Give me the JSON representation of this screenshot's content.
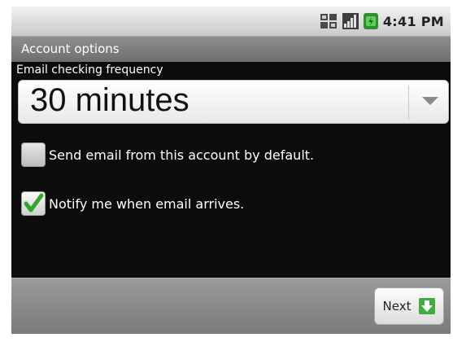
{
  "status_bar": {
    "time": "4:41 PM",
    "icons": [
      "sim-icon",
      "signal-icon",
      "battery-icon"
    ],
    "accent": "#3aa33a"
  },
  "title_bar": {
    "title": "Account options"
  },
  "frequency": {
    "label": "Email checking frequency",
    "selected": "30 minutes"
  },
  "checkboxes": [
    {
      "label": "Send email from this account by default.",
      "checked": false
    },
    {
      "label": "Notify me when email arrives.",
      "checked": true,
      "check_color": "#2fa82f"
    }
  ],
  "footer": {
    "next_label": "Next",
    "next_icon": "green-arrow-down-icon"
  }
}
